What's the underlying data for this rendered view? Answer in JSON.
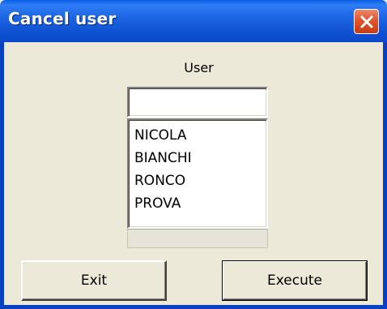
{
  "window": {
    "title": "Cancel user",
    "close_icon": "close-icon"
  },
  "form": {
    "user_label": "User",
    "user_input_value": "",
    "users": [
      "NICOLA",
      "BIANCHI",
      "RONCO",
      "PROVA"
    ]
  },
  "buttons": {
    "exit_label": "Exit",
    "execute_label": "Execute"
  },
  "colors": {
    "titlebar": "#0A48C8",
    "dialog_bg": "#ECE9D8",
    "close_button": "#E0552C"
  }
}
